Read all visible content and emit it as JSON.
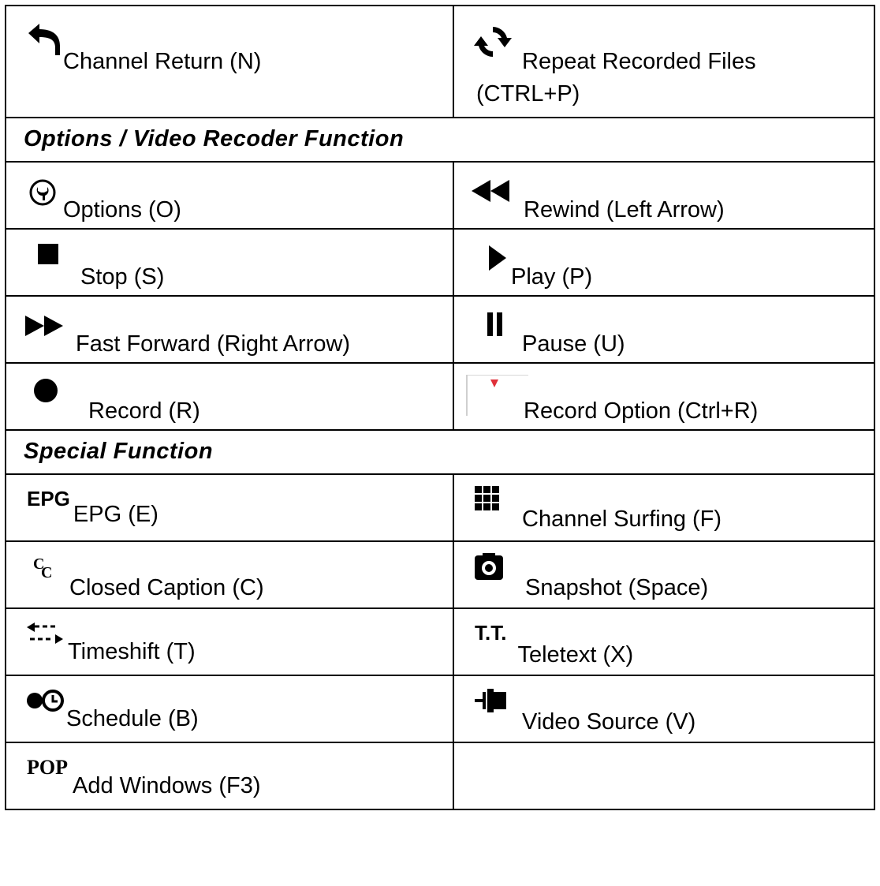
{
  "rows": {
    "channel_return": "Channel Return (N)",
    "repeat_files_line1": "Repeat Recorded Files",
    "repeat_files_line2": "(CTRL+P)",
    "section_options": "Options / Video Recoder Function",
    "options": "Options (O)",
    "rewind": "Rewind (Left Arrow)",
    "stop": "Stop (S)",
    "play": "Play (P)",
    "fast_forward": "Fast Forward (Right Arrow)",
    "pause": "Pause (U)",
    "record": "Record (R)",
    "record_option": "Record Option (Ctrl+R)",
    "section_special": "Special Function",
    "epg": "EPG (E)",
    "channel_surfing": "Channel Surfing (F)",
    "closed_caption": "Closed Caption (C)",
    "snapshot": "Snapshot (Space)",
    "timeshift": "Timeshift (T)",
    "teletext": "Teletext (X)",
    "schedule": "Schedule (B)",
    "video_source": "Video Source (V)",
    "add_windows": "Add Windows (F3)"
  },
  "icon_text": {
    "epg": "EPG",
    "cc": "CC",
    "tt": "T.T.",
    "pop": "POP"
  },
  "colors": {
    "record_option_arrow": "#e0303a"
  }
}
